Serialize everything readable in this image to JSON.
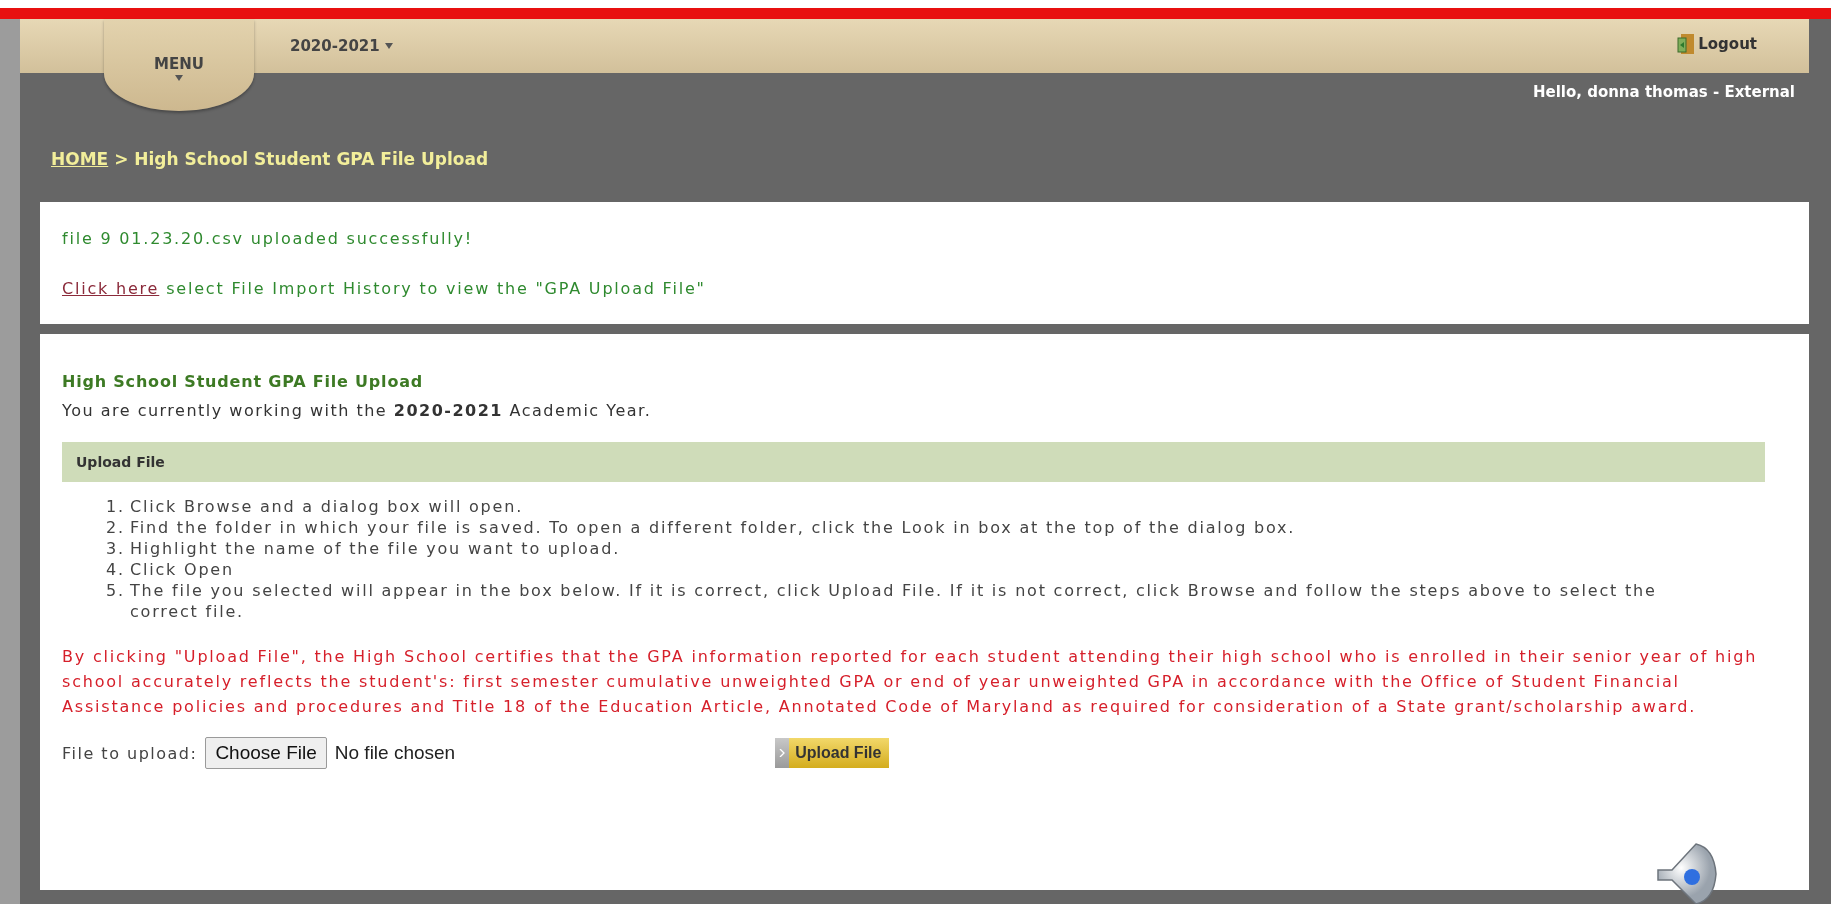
{
  "header": {
    "menu_label": "MENU",
    "year": "2020-2021",
    "logout": "Logout",
    "greeting": "Hello, donna thomas - External"
  },
  "breadcrumb": {
    "home": "HOME",
    "current": "> High School Student GPA File Upload"
  },
  "message": {
    "success": "file 9 01.23.20.csv uploaded successfully!",
    "link": "Click here",
    "note": "select File Import History to view the \"GPA Upload File\""
  },
  "upload_panel": {
    "title": "High School Student GPA File Upload",
    "intro": "You are currently working with the **2020-2021** Academic Year.",
    "section": "Upload File",
    "steps": [
      {
        "number": "1.",
        "text": "Click Browse and a dialog box will open."
      },
      {
        "number": "2.",
        "text": "Find the folder in which your file is saved. To open a different folder, click the Look in box at the top of the dialog box."
      },
      {
        "number": "3.",
        "text": "Highlight the name of the file you want to upload."
      },
      {
        "number": "4.",
        "text": "Click Open"
      },
      {
        "number": "5.",
        "text": "The file you selected will appear in the box below. If it is correct, click Upload File. If it is not correct, click Browse and follow the steps above to select the correct file."
      }
    ],
    "certification": "By clicking \"Upload File\", the High School certifies that the GPA information reported for each student attending their high school who is enrolled in their senior year of high school accurately reflects the student's: first semester cumulative unweighted GPA or end of year unweighted GPA in accordance with the Office of Student Financial Assistance policies and procedures and Title 18 of the Education Article, Annotated Code of Maryland as required for consideration of a State grant/scholarship award.",
    "file_label": "File to upload:",
    "choose_button": "Choose File",
    "file_status": "No file chosen",
    "upload_button": "Upload File"
  }
}
